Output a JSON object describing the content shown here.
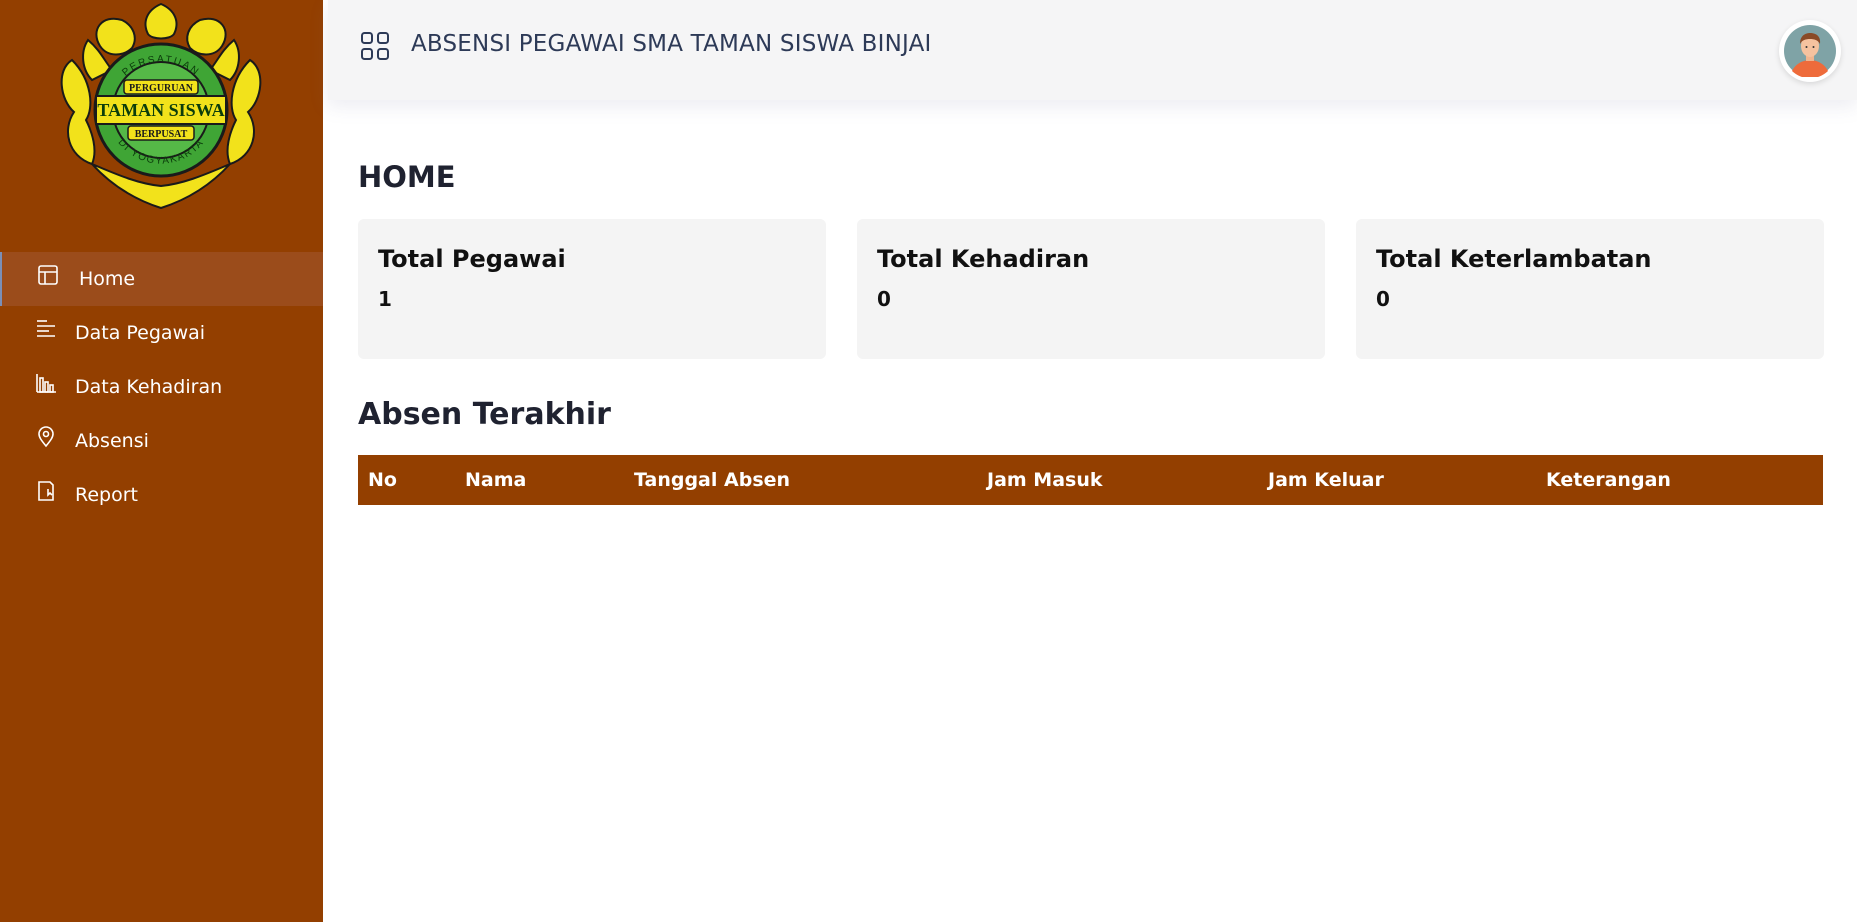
{
  "app": {
    "title": "ABSENSI PEGAWAI SMA TAMAN SISWA BINJAI",
    "logo_text": {
      "top": "PERSATUAN",
      "line1": "PERGURUAN",
      "main": "TAMAN SISWA",
      "line2": "BERPUSAT",
      "bottom": "DI YOGYAKARTA"
    }
  },
  "sidebar": {
    "items": [
      {
        "label": "Home",
        "icon": "layout-icon",
        "active": true
      },
      {
        "label": "Data Pegawai",
        "icon": "list-icon"
      },
      {
        "label": "Data Kehadiran",
        "icon": "bar-chart-icon"
      },
      {
        "label": "Absensi",
        "icon": "location-pin-icon"
      },
      {
        "label": "Report",
        "icon": "document-icon"
      }
    ]
  },
  "main": {
    "page_title": "HOME",
    "cards": [
      {
        "title": "Total Pegawai",
        "value": "1"
      },
      {
        "title": "Total Kehadiran",
        "value": "0"
      },
      {
        "title": "Total Keterlambatan",
        "value": "0"
      }
    ],
    "section_title": "Absen Terakhir",
    "table": {
      "columns": [
        "No",
        "Nama",
        "Tanggal Absen",
        "Jam Masuk",
        "Jam Keluar",
        "Keterangan"
      ],
      "rows": []
    }
  },
  "colors": {
    "sidebar": "#933f00",
    "header_bg": "#f5f5f6",
    "card_bg": "#f4f4f4",
    "table_head": "#933f00"
  }
}
